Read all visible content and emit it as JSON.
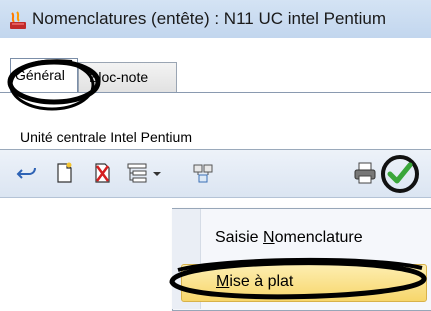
{
  "window": {
    "title": "Nomenclatures (entête)  : N11 UC intel Pentium"
  },
  "tabs": [
    {
      "label": "Général"
    },
    {
      "label": "Bloc-note"
    }
  ],
  "description": {
    "value": "Unité centrale Intel Pentium"
  },
  "toolbar": {
    "items": [
      {
        "icon": "undo-icon"
      },
      {
        "icon": "new-document-icon"
      },
      {
        "icon": "delete-document-icon"
      },
      {
        "icon": "tree-structure-icon"
      },
      {
        "icon": "dropdown-arrow-icon"
      },
      {
        "icon": "components-icon"
      },
      {
        "icon": "printer-icon"
      },
      {
        "icon": "validate-checkmark-icon"
      }
    ]
  },
  "menu": {
    "items": [
      {
        "before": "Saisie ",
        "accel": "N",
        "after": "omenclature"
      },
      {
        "before": "",
        "accel": "M",
        "after": "ise à plat"
      }
    ]
  },
  "colors": {
    "highlight": "#f7d66b",
    "titlebar": "#c2d6ee",
    "check": "#3aa63a"
  }
}
